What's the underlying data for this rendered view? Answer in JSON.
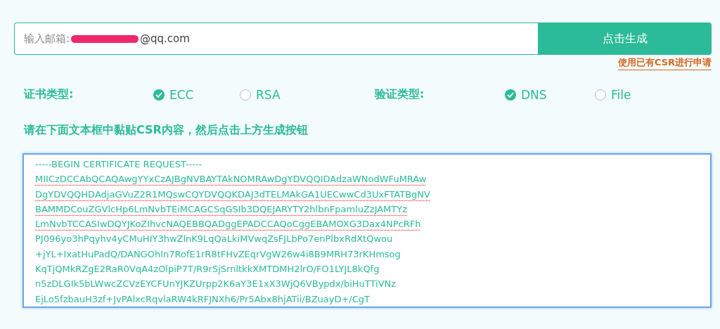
{
  "email_field": {
    "label": "输入邮箱:",
    "value": "@qq.com",
    "redacted": true
  },
  "generate_button": {
    "label": "点击生成"
  },
  "csr_link": {
    "label": "使用已有CSR进行申请"
  },
  "option_groups": [
    {
      "label": "证书类型:",
      "options": [
        {
          "label": "ECC",
          "selected": true
        },
        {
          "label": "RSA",
          "selected": false
        }
      ]
    },
    {
      "label": "验证类型:",
      "options": [
        {
          "label": "DNS",
          "selected": true
        },
        {
          "label": "File",
          "selected": false
        }
      ]
    }
  ],
  "instruction": "请在下面文本框中黏贴CSR内容，然后点击上方生成按钮",
  "csr_text": {
    "focused": true,
    "lines": [
      {
        "text": "-----BEGIN CERTIFICATE REQUEST-----",
        "misspelled": false
      },
      {
        "text": "MIICzDCCAbQCAQAwgYYxCzAJBgNVBAYTAkNOMRAwDgYDVQQIDAdzaWNodWFuMRAw",
        "misspelled": true
      },
      {
        "text": "DgYDVQQHDAdjaGVuZ2R1MQswCQYDVQQKDAJ3dTELMAkGA1UECwwCd3UxFTATBgNV",
        "misspelled": true
      },
      {
        "text": "BAMMDCouZGVlcHp6LmNvbTEiMCAGCSqGSIb3DQEJARYTY2hlbnFpamluZzJAMTYz",
        "misspelled": true
      },
      {
        "text": "LmNvbTCCASIwDQYJKoZIhvcNAQEBBQADggEPADCCAQoCggEBAMOXG3Dax4NPcRFh",
        "misspelled": true
      },
      {
        "text": "PJ096yo3hPqyhv4yCMuHIY3hwZlnK9LqQaLkiMVwqZsFJLbPo7enPlbxRdXtQwou",
        "misspelled": false
      },
      {
        "text": "+jYL+IxatHuPadQ/DANGOhIn7RofE1rR8tFHvZEqrVgW26w4i8B9MRH73rKHmsog",
        "misspelled": false
      },
      {
        "text": "KqTjQMkRZgE2RaR0VqA4zOlpiP7T/R9rSjSrnltkkXMTDMH2lrO/FO1LYJL8kQfg",
        "misspelled": false
      },
      {
        "text": "n5zDLGIk5bLWwcZCVzEYCFUnYJKZUrpp2K6aY3E1xX3WjQ6VBypdx/biHuTTiVNz",
        "misspelled": false
      },
      {
        "text": "EjLo5fzbauH3zf+JvPAlxcRqvlaRW4kRFJNXh6/Pr5Abx8hjATii/BZuayD+/CgT",
        "misspelled": false
      }
    ]
  }
}
